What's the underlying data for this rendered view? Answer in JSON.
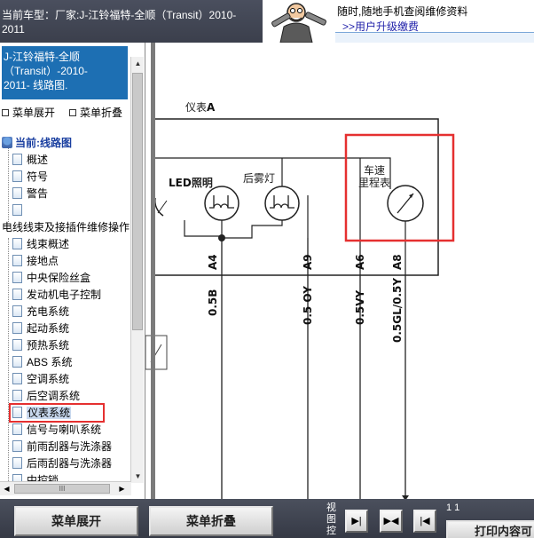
{
  "header": {
    "car_model_line1": "当前车型：厂家:J-江铃福特-全顺（Transit）2010-",
    "car_model_line2": "2011",
    "ad_line1": "随时,随地手机查阅维修资料",
    "ad_line2": ">>用户升级缴费"
  },
  "sidebar": {
    "title_line1": "J-江铃福特-全顺",
    "title_line2": "（Transit）-2010-",
    "title_line3": "2011- 线路图.",
    "expand_label": "菜单展开",
    "collapse_label": "菜单折叠",
    "tree": {
      "root_label": "当前:线路图",
      "items": [
        "概述",
        "符号",
        "警告",
        "",
        "电线线束及接插件维修操作",
        "线束概述",
        "接地点",
        "中央保险丝盒",
        "发动机电子控制",
        "充电系统",
        "起动系统",
        "预热系统",
        "ABS 系统",
        "空调系统",
        "后空调系统",
        "仪表系统",
        "信号与喇叭系统",
        "前雨刮器与洗涤器",
        "后雨刮器与洗涤器",
        "中控锁"
      ],
      "selected": "仪表系统"
    },
    "hscroll_grip": "III"
  },
  "diagram": {
    "module_label": "仪表",
    "module_label_letter": "A",
    "led_label": "LED",
    "led_label_suffix": "照明",
    "fog_label": "后雾灯",
    "speedo_line1": "车速",
    "speedo_line2": "里程表",
    "pins": [
      "A4",
      "A9",
      "A6",
      "A8"
    ],
    "wires": [
      "0.5B",
      "0.5 OY",
      "0.5VY",
      "0.5GL/0.5Y"
    ]
  },
  "toolbar": {
    "expand_label": "菜单展开",
    "collapse_label": "菜单折叠",
    "view_label": "视图控",
    "page_count": "1 1",
    "print_label": "打印内容可",
    "nav_next": "▶|",
    "nav_both": "▶◀",
    "nav_prev": "|◀"
  },
  "colors": {
    "header_bg": "#3f4350",
    "title_box": "#1d6fb3",
    "highlight_red": "#e53030",
    "link_blue": "#2222aa"
  }
}
